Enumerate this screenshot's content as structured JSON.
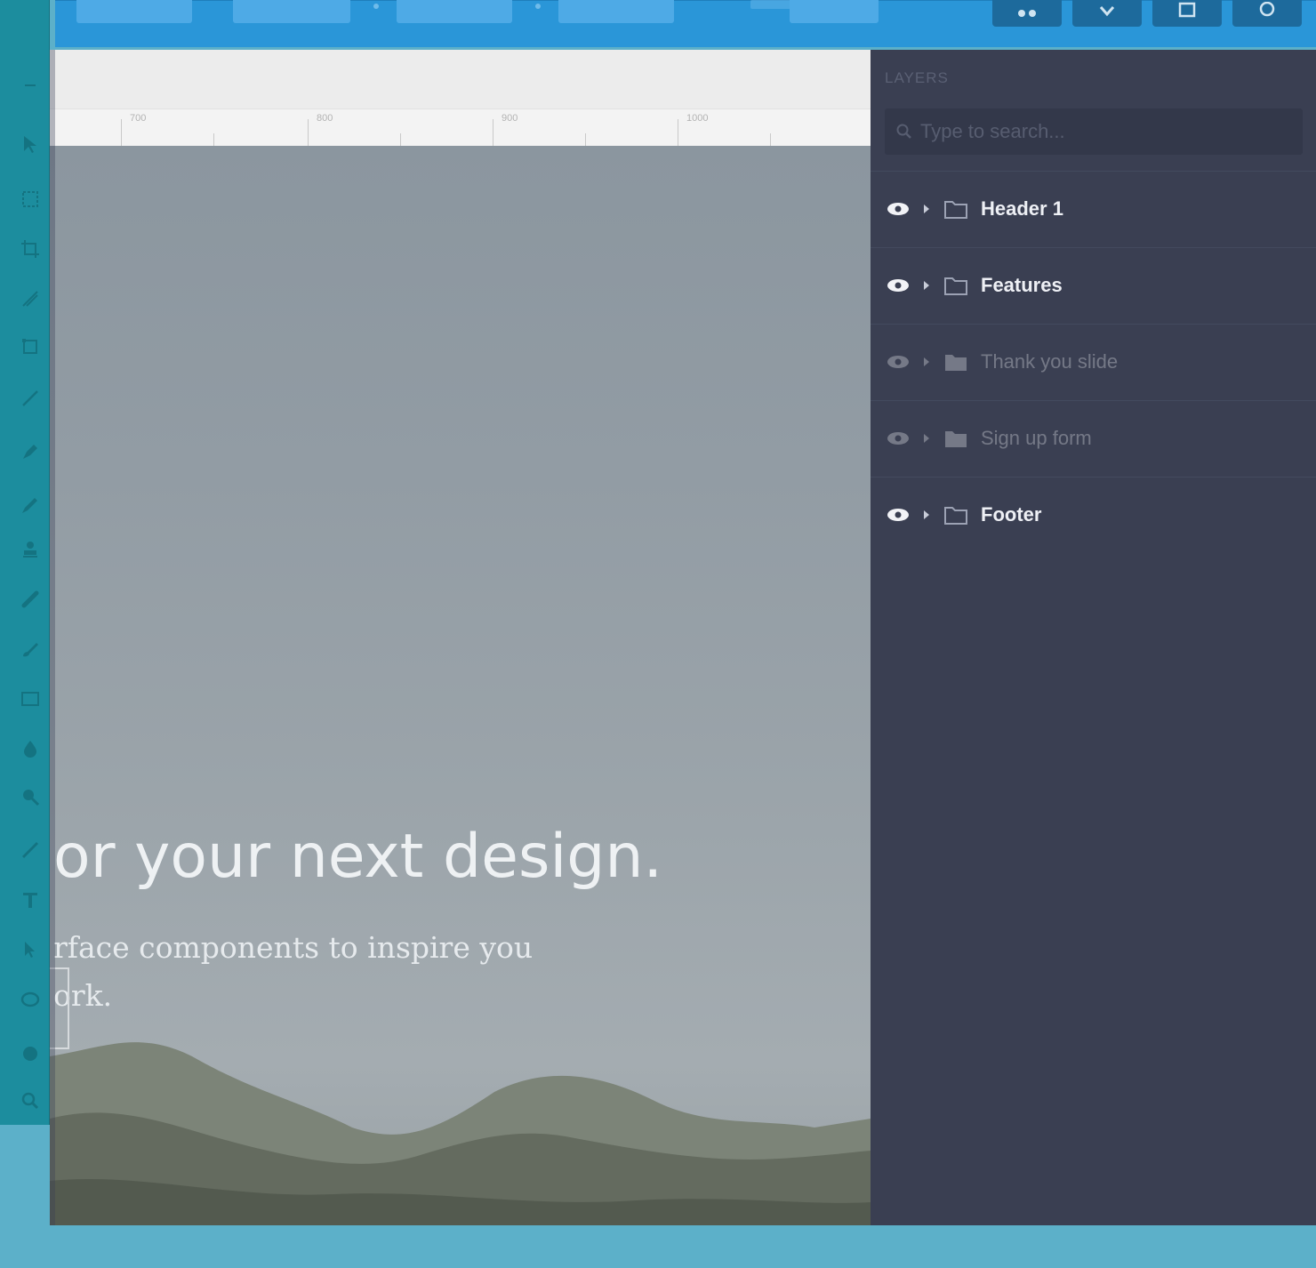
{
  "toolbar": {
    "buttons": [
      "",
      "",
      "",
      "",
      ""
    ],
    "icon_buttons": [
      "share-icon",
      "download-icon",
      "save-icon",
      "settings-icon"
    ]
  },
  "toolrail": {
    "tools": [
      "collapse-icon",
      "select-icon",
      "marquee-icon",
      "crop-icon",
      "slice-icon",
      "transform-icon",
      "line-icon",
      "pen-icon",
      "pencil-icon",
      "stamp-icon",
      "heal-icon",
      "brush-icon",
      "rectangle-icon",
      "fill-icon",
      "zoom-icon",
      "blur-icon",
      "text-icon",
      "pointer-icon",
      "ellipse-icon",
      "hand-icon",
      "magnifier-icon"
    ]
  },
  "ruler": {
    "labels": [
      "700",
      "800",
      "900",
      "1000"
    ]
  },
  "canvas": {
    "hero_title": "or your next design.",
    "hero_subtitle_line1": "rface components to inspire you",
    "hero_subtitle_line2": "ork."
  },
  "layers": {
    "title": "LAYERS",
    "search_placeholder": "Type to search...",
    "items": [
      {
        "label": "Header 1",
        "visible": true
      },
      {
        "label": "Features",
        "visible": true
      },
      {
        "label": "Thank you slide",
        "visible": false
      },
      {
        "label": "Sign up form",
        "visible": false
      },
      {
        "label": "Footer",
        "visible": true
      }
    ]
  },
  "colors": {
    "toolbar": "#2a96d8",
    "toolrail": "#1c8d9e",
    "panel": "#3a3f52",
    "background": "#5cb0c9"
  }
}
